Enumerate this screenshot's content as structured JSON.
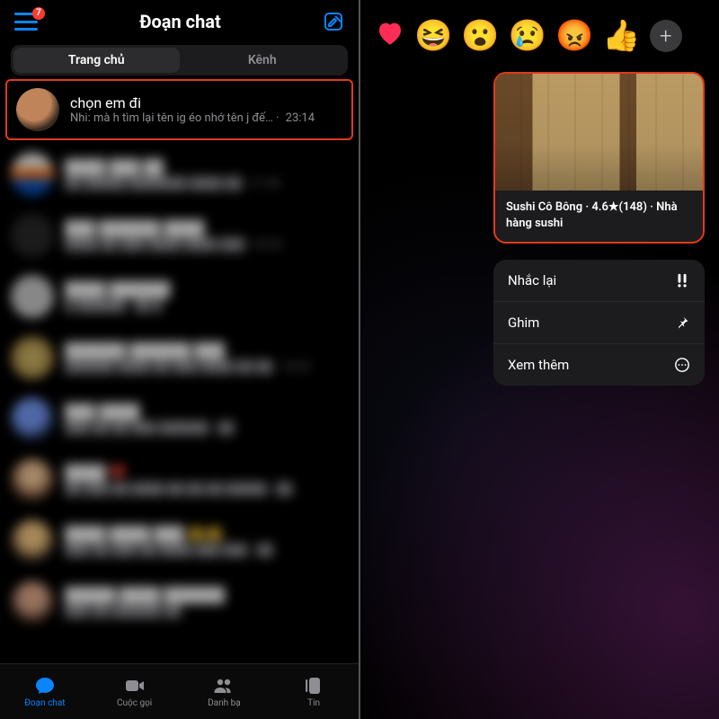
{
  "header": {
    "title": "Đoạn chat",
    "badge": "7"
  },
  "tabs": {
    "home": "Trang chủ",
    "channels": "Kênh"
  },
  "chats": {
    "first": {
      "title": "chọn em đi",
      "subtitle": "Nhi: mà h tìm lại tên ig éo nhớ tên j đế…",
      "time": "23:14"
    }
  },
  "nav": {
    "chats": "Đoạn chat",
    "calls": "Cuộc gọi",
    "people": "Danh bạ",
    "stories": "Tin"
  },
  "reactions": {
    "heart": "❤️",
    "laugh": "😆",
    "wow": "😮",
    "sad": "😢",
    "angry": "😡",
    "like": "👍",
    "add": "+"
  },
  "card": {
    "text": "Sushi Cô Bông · 4.6★(148) · Nhà hàng sushi"
  },
  "menu": {
    "remind": "Nhắc lại",
    "pin": "Ghim",
    "more": "Xem thêm"
  }
}
